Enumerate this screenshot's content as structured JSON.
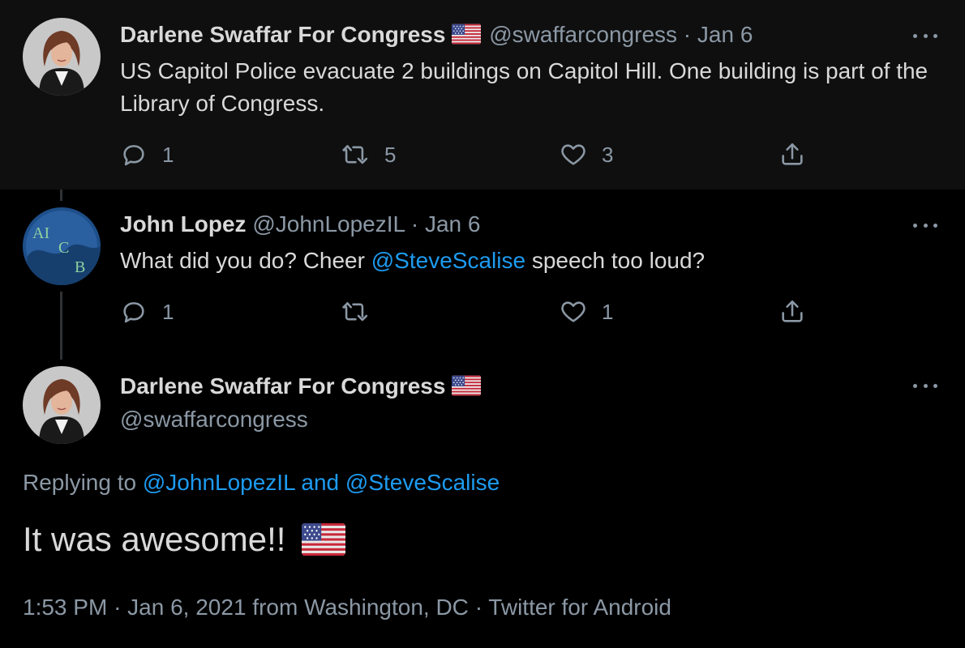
{
  "colors": {
    "background": "#000000",
    "first_tweet_bg": "#0f0f0f",
    "text": "#d9d9d9",
    "muted": "#8b98a5",
    "link": "#1d9bf0",
    "thread_line": "#2f3336"
  },
  "tweets": [
    {
      "display_name": "Darlene Swaffar For Congress",
      "verified_flag_icon": "us-flag-emoji",
      "handle": "@swaffarcongress",
      "separator": "·",
      "date": "Jan 6",
      "text": "US Capitol Police evacuate 2 buildings on Capitol Hill. One building is part of the Library of Congress.",
      "reply_count": "1",
      "retweet_count": "5",
      "like_count": "3"
    },
    {
      "display_name": "John Lopez",
      "handle": "@JohnLopezIL",
      "separator": "·",
      "date": "Jan 6",
      "text_before": "What did you do? Cheer ",
      "mention": "@SteveScalise",
      "text_after": " speech too loud?",
      "reply_count": "1",
      "retweet_count": "",
      "like_count": "1"
    }
  ],
  "main_tweet": {
    "display_name": "Darlene Swaffar For Congress",
    "handle": "@swaffarcongress",
    "replying_prefix": "Replying to",
    "replying_user1": "@JohnLopezIL",
    "replying_and": "and",
    "replying_user2": "@SteveScalise",
    "text": "It was awesome!!",
    "time": "1:53 PM",
    "separator": "·",
    "date": "Jan 6, 2021",
    "from_text": "from Washington, DC",
    "source": "Twitter for Android"
  }
}
